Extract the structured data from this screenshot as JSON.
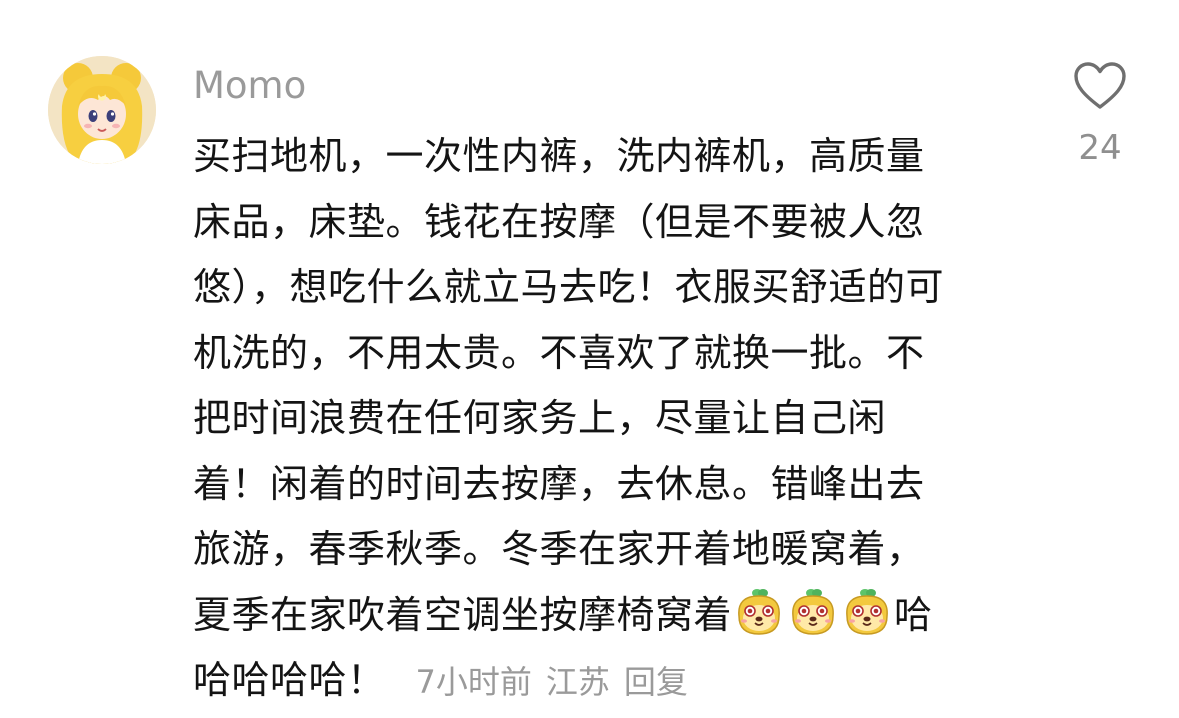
{
  "comment": {
    "username": "Momo",
    "lines": [
      "买扫地机，一次性内裤，洗内裤机，高质量",
      "床品，床垫。钱花在按摩（但是不要被人忽",
      "悠），想吃什么就立马去吃！衣服买舒适的可",
      "机洗的，不用太贵。不喜欢了就换一批。不",
      "把时间浪费在任何家务上，尽量让自己闲",
      "着！闲着的时间去按摩，去休息。错峰出去",
      "旅游，春季秋季。冬季在家开着地暖窝着，",
      "夏季在家吹着空调坐按摩椅窝着",
      "哈",
      "哈哈哈哈！"
    ],
    "emoji_icon": "smiling-puppy-emoji",
    "time": "7小时前",
    "location": "江苏",
    "reply_label": "回复",
    "likes": "24",
    "like_icon": "heart-outline-icon"
  },
  "colors": {
    "text": "#141414",
    "muted": "#9a9a9a",
    "background": "#ffffff"
  }
}
